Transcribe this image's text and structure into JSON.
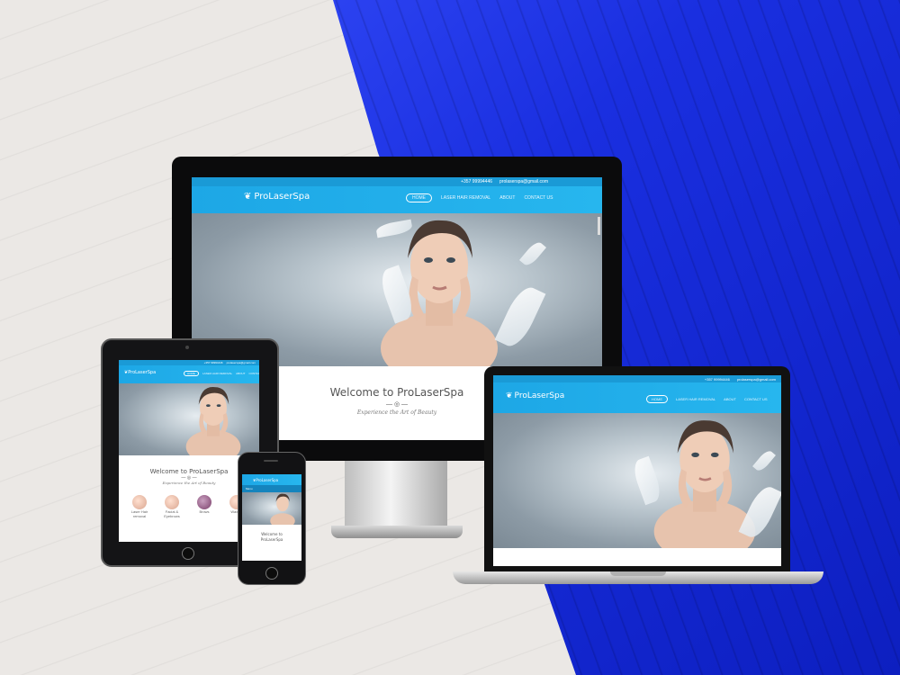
{
  "site": {
    "brand": "ProLaserSpa",
    "phone": "+357 99994446",
    "email": "prolaserspa@gmail.com",
    "nav": [
      "HOME",
      "LASER HAIR REMOVAL",
      "ABOUT",
      "CONTACT US"
    ],
    "welcome": "Welcome to ProLaserSpa",
    "tagline": "Experience the Art of Beauty",
    "services": [
      "Laser Hair removal",
      "Facial & Eyebrows",
      "Brows",
      "Waxing"
    ]
  },
  "phone_screen": {
    "menu": "Menu",
    "welcome": "Welcome to ProLaserSpa"
  },
  "colors": {
    "site_blue": "#1da7e6",
    "bg_blue": "#1a2fe0",
    "bg_light": "#ebe8e5"
  }
}
